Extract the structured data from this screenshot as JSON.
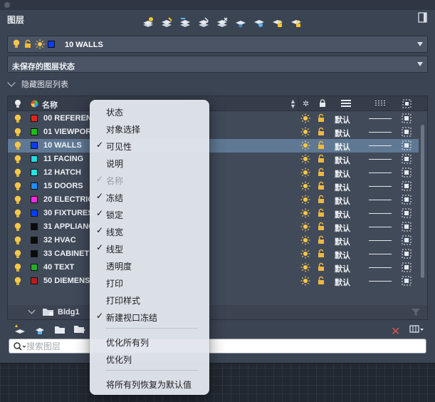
{
  "palette": {
    "title": "图层",
    "current_layer": "10 WALLS",
    "current_layer_color": "#0a3cff",
    "layer_state": "未保存的图层状态",
    "hidden_list_label": "隐藏图层列表"
  },
  "table": {
    "name_header": "名称",
    "default_label": "默认",
    "rows": [
      {
        "name": "00 REFEREN",
        "color": "#e0261c",
        "selected": false
      },
      {
        "name": "01 VIEWPOR",
        "color": "#1dbf1d",
        "selected": false
      },
      {
        "name": "10 WALLS",
        "color": "#0a3cff",
        "selected": true
      },
      {
        "name": "11 FACING",
        "color": "#26d9e3",
        "selected": false
      },
      {
        "name": "12 HATCH",
        "color": "#26e3e3",
        "selected": false
      },
      {
        "name": "15 DOORS",
        "color": "#1f8fff",
        "selected": false
      },
      {
        "name": "20 ELECTRIC",
        "color": "#ea2fe0",
        "selected": false
      },
      {
        "name": "30 FIXTURES",
        "color": "#0a3cff",
        "selected": false
      },
      {
        "name": "31 APPLIANC",
        "color": "#0b0b0b",
        "selected": false
      },
      {
        "name": "32 HVAC",
        "color": "#0b0b0b",
        "selected": false
      },
      {
        "name": "33 CABINET",
        "color": "#0b0b0b",
        "selected": false
      },
      {
        "name": "40 TEXT",
        "color": "#28a928",
        "selected": false
      },
      {
        "name": "50 DIEMENS",
        "color": "#b0201a",
        "selected": false
      }
    ],
    "group": "Bldg1"
  },
  "search": {
    "placeholder": "搜索图层"
  },
  "context_menu": {
    "items": [
      {
        "label": "状态",
        "checked": false,
        "disabled": false
      },
      {
        "label": "对象选择",
        "checked": false,
        "disabled": false
      },
      {
        "label": "可见性",
        "checked": true,
        "disabled": false
      },
      {
        "label": "说明",
        "checked": false,
        "disabled": false
      },
      {
        "label": "名称",
        "checked": true,
        "disabled": true
      },
      {
        "label": "冻结",
        "checked": true,
        "disabled": false
      },
      {
        "label": "锁定",
        "checked": true,
        "disabled": false
      },
      {
        "label": "线宽",
        "checked": true,
        "disabled": false
      },
      {
        "label": "线型",
        "checked": true,
        "disabled": false
      },
      {
        "label": "透明度",
        "checked": false,
        "disabled": false
      },
      {
        "label": "打印",
        "checked": false,
        "disabled": false
      },
      {
        "label": "打印样式",
        "checked": false,
        "disabled": false
      },
      {
        "label": "新建视口冻结",
        "checked": true,
        "disabled": false
      },
      {
        "label": "优化所有列",
        "checked": false,
        "disabled": false
      },
      {
        "label": "优化列",
        "checked": false,
        "disabled": false
      },
      {
        "label": "将所有列恢复为默认值",
        "checked": false,
        "disabled": false
      }
    ]
  },
  "icons": {
    "bulb": "lightbulb-icon",
    "sun": "sun-icon",
    "lock": "lock-icon",
    "plot": "plot-icon"
  }
}
